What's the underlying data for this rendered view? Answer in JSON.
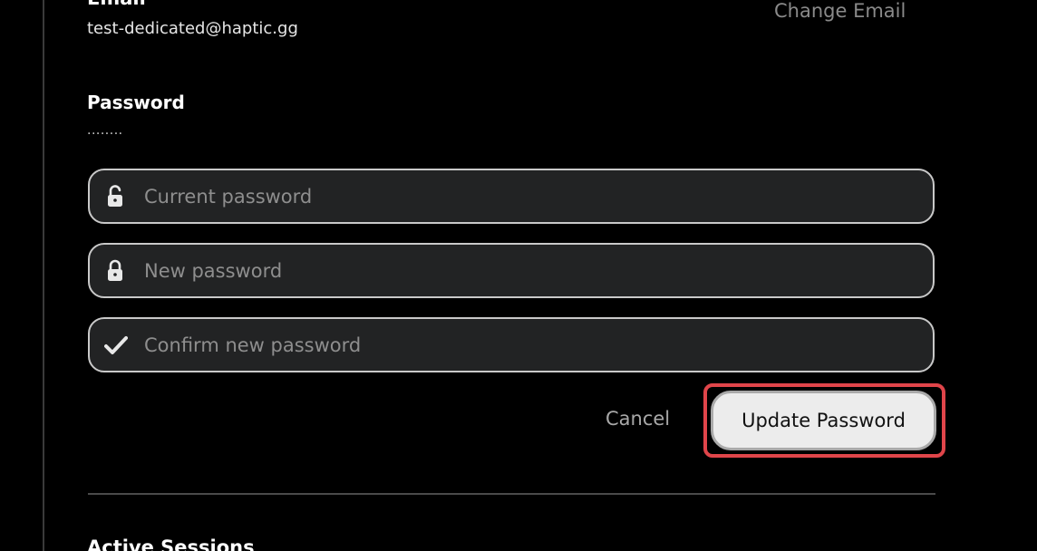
{
  "account": {
    "email_heading": "Email",
    "email_value": "test-dedicated@haptic.gg",
    "change_email_label": "Change Email",
    "password_heading": "Password",
    "password_mask": "........"
  },
  "password_form": {
    "current_placeholder": "Current password",
    "current_icon": "unlocked-padlock-icon",
    "new_placeholder": "New password",
    "new_icon": "locked-padlock-icon",
    "confirm_placeholder": "Confirm new password",
    "confirm_icon": "checkmark-icon",
    "cancel_label": "Cancel",
    "update_label": "Update Password"
  },
  "sessions": {
    "heading": "Active Sessions"
  },
  "colors": {
    "background": "#000000",
    "field_background": "#222324",
    "field_border": "#c9c9c9",
    "highlight": "#e0454a",
    "button_background": "#ececec"
  }
}
